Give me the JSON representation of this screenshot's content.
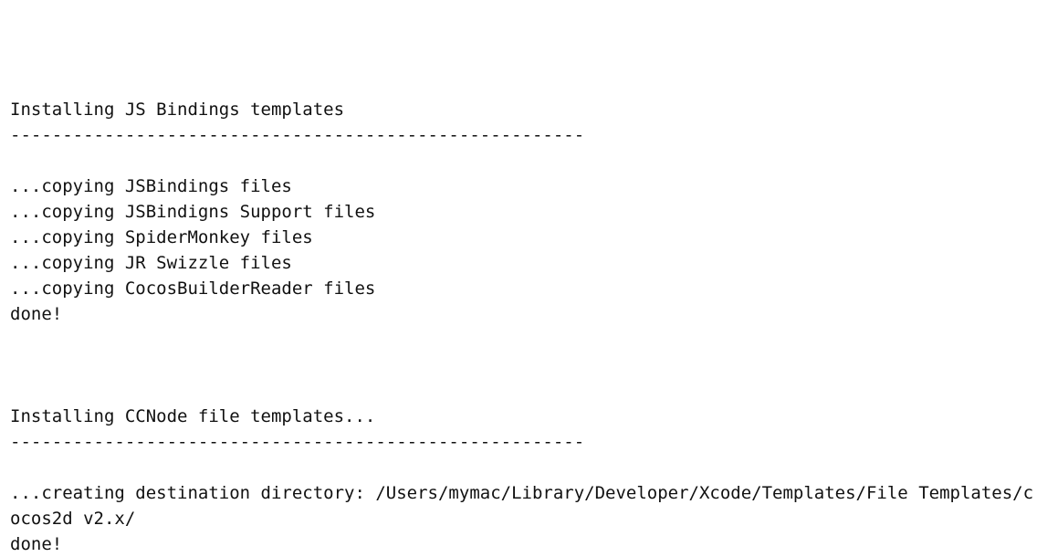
{
  "terminal": {
    "background_color": "#ffffff",
    "text_color": "#111111",
    "top_blank_lines": [
      "",
      ""
    ],
    "sections": [
      {
        "title": "Installing JS Bindings templates",
        "separator": "-------------------------------------------------------",
        "blank_after_separator": "",
        "lines": [
          "...copying JSBindings files",
          "...copying JSBindigns Support files",
          "...copying SpiderMonkey files",
          "...copying JR Swizzle files",
          "...copying CocosBuilderReader files",
          "done!"
        ],
        "trailing_blank_lines": [
          "",
          "",
          ""
        ]
      },
      {
        "title": "Installing CCNode file templates...",
        "separator": "-------------------------------------------------------",
        "blank_after_separator": "",
        "lines": [
          "...creating destination directory: /Users/mymac/Library/Developer/Xcode/Templates/File Templates/cocos2d v2.x/",
          "done!"
        ],
        "trailing_blank_lines": []
      }
    ]
  }
}
